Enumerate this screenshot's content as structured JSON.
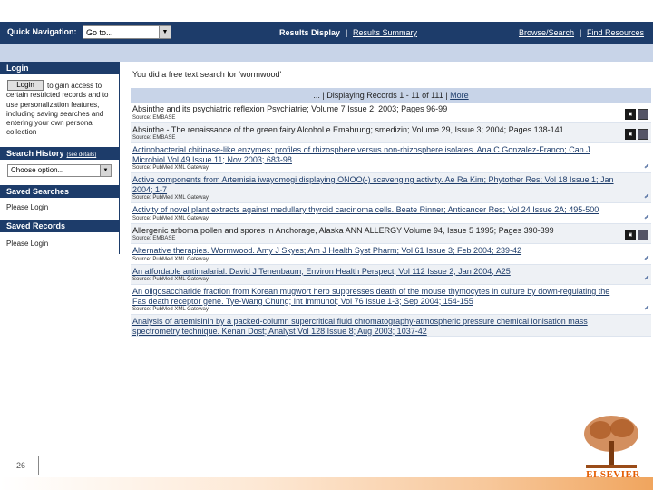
{
  "nav": {
    "quick_navigation": "Quick Navigation:",
    "goto_value": "Go to...",
    "results_display": "Results Display",
    "sep": "|",
    "results_summary": "Results Summary",
    "browse_search": "Browse/Search",
    "find_resources": "Find Resources"
  },
  "sidebar": {
    "login_heading": "Login",
    "login_button": "Login",
    "login_text": "to gain access to certain restricted records and to use personalization features, including saving searches and entering your own personal collection",
    "search_history_heading": "Search History",
    "search_history_link": "(see details)",
    "choose_option": "Choose option...",
    "saved_searches_heading": "Saved Searches",
    "saved_searches_text": "Please Login",
    "saved_records_heading": "Saved Records",
    "saved_records_text": "Please Login"
  },
  "main": {
    "query_text": "You did a free text search for 'wormwood'",
    "pager_prefix": "... | Displaying Records 1 - 11 of 111 |",
    "pager_more": "More",
    "records": [
      {
        "title": "Absinthe and its psychiatric reflexion Psychiatrie; Volume 7 Issue 2; 2003; Pages 96-99",
        "source": "Source: EMBASE",
        "link": false
      },
      {
        "title": "Absinthe - The renaissance of the green fairy Alcohol e Emahrung; smedizin; Volume 29, Issue 3; 2004; Pages 138-141",
        "source": "Source: EMBASE",
        "link": false
      },
      {
        "title": "Actinobacterial chitinase-like enzymes: profiles of rhizosphere versus non-rhizosphere isolates. Ana C Gonzalez-Franco; Can J Microbiol Vol 49 Issue 11; Nov 2003; 683-98",
        "source": "Source: PubMed XML Gateway",
        "link": true
      },
      {
        "title": "Active components from Artemisia iwayomogi displaying ONOO(-) scavenging activity. Ae Ra Kim; Phytother Res; Vol 18 Issue 1; Jan 2004; 1-7",
        "source": "Source: PubMed XML Gateway",
        "link": true
      },
      {
        "title": "Activity of novel plant extracts against medullary thyroid carcinoma cells. Beate Rinner; Anticancer Res; Vol 24 Issue 2A; 495-500",
        "source": "Source: PubMed XML Gateway",
        "link": true
      },
      {
        "title": "Allergenic arboma pollen and spores in Anchorage, Alaska ANN ALLERGY Volume 94, Issue 5 1995; Pages 390-399",
        "source": "Source: EMBASE",
        "link": false
      },
      {
        "title": "Alternative therapies. Wormwood. Amy J Skyes; Am J Health Syst Pharm; Vol 61 Issue 3; Feb 2004; 239-42",
        "source": "Source: PubMed XML Gateway",
        "link": true
      },
      {
        "title": "An affordable antimalarial. David J Tenenbaum; Environ Health Perspect; Vol 112 Issue 2; Jan 2004; A25",
        "source": "Source: PubMed XML Gateway",
        "link": true
      },
      {
        "title": "An oligosaccharide fraction from Korean mugwort herb suppresses death of the mouse thymocytes in culture by down-regulating the Fas death receptor gene. Tye-Wang Chung; Int Immunol; Vol 76 Issue 1-3; Sep 2004; 154-155",
        "source": "Source: PubMed XML Gateway",
        "link": true
      },
      {
        "title": "Analysis of artemisinin by a packed-column supercritical fluid chromatography-atmospheric pressure chemical ionisation mass spectrometry technique. Kenan Dost; Analyst Vol 128 Issue 8; Aug 2003; 1037-42",
        "source": "",
        "link": true
      }
    ]
  },
  "footer": {
    "page_number": "26",
    "logo_text": "ELSEVIER"
  },
  "colors": {
    "nav_bg": "#1d3c6a",
    "light_band": "#c8d4e8",
    "brand_orange": "#e35b00"
  }
}
